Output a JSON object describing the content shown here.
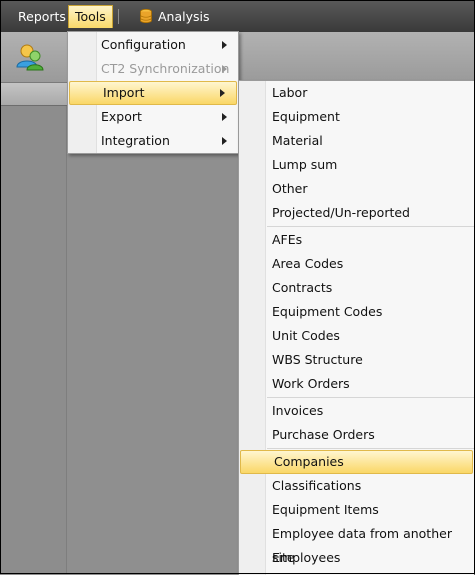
{
  "menubar": {
    "reports": "Reports",
    "tools": "Tools",
    "analysis": "Analysis"
  },
  "tools_menu": {
    "items": [
      {
        "label": "Configuration",
        "disabled": false,
        "submenu": true
      },
      {
        "label": "CT2 Synchronization",
        "disabled": true,
        "submenu": true
      },
      {
        "label": "Import",
        "disabled": false,
        "submenu": true,
        "highlighted": true
      },
      {
        "label": "Export",
        "disabled": false,
        "submenu": true
      },
      {
        "label": "Integration",
        "disabled": false,
        "submenu": true
      }
    ]
  },
  "import_menu": {
    "group1": [
      "Labor",
      "Equipment",
      "Material",
      "Lump sum",
      "Other",
      "Projected/Un-reported"
    ],
    "group2": [
      "AFEs",
      "Area Codes",
      "Contracts",
      "Equipment Codes",
      "Unit Codes",
      "WBS Structure",
      "Work Orders"
    ],
    "group3": [
      "Invoices",
      "Purchase Orders"
    ],
    "group4": [
      "Companies",
      "Classifications",
      "Equipment Items",
      "Employee data from another site",
      "Employees"
    ],
    "highlighted": "Companies"
  },
  "colors": {
    "highlight_top": "#fff6d0",
    "highlight_bottom": "#fad767",
    "menubar": "#3a3a3a",
    "background": "#8f8f8f"
  },
  "icons": {
    "ribbon": "users-icon",
    "analysis": "database-icon",
    "submenu": "chevron-right-icon"
  }
}
